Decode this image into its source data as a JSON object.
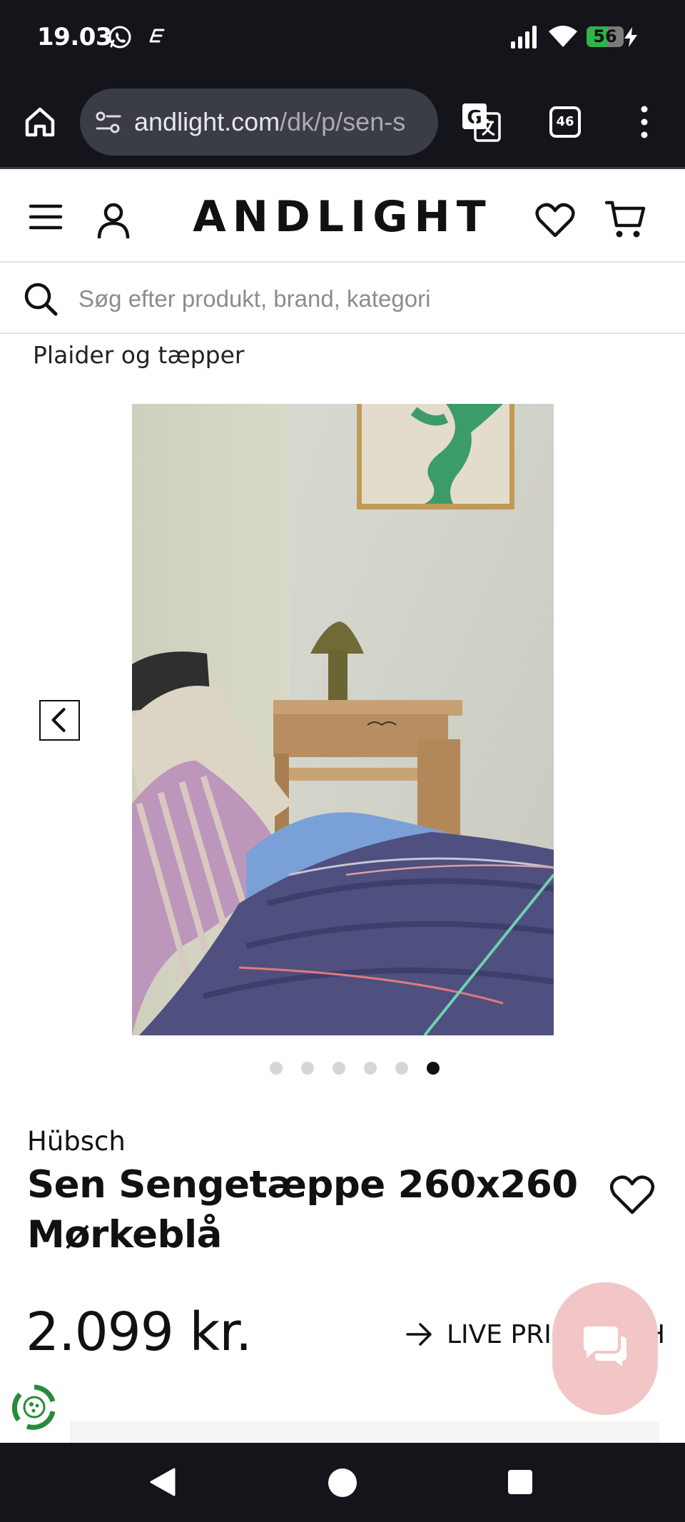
{
  "status_bar": {
    "time": "19.03",
    "battery_percent": "56",
    "battery_level": 0.56,
    "icons": [
      "whatsapp-icon",
      "e-notification-icon",
      "signal-icon",
      "wifi-icon",
      "battery-icon",
      "charging-bolt-icon"
    ]
  },
  "browser": {
    "url_domain": "andlight.com",
    "url_path": "/dk/p/sen-s",
    "tab_count": "46",
    "icons": [
      "home-icon",
      "site-settings-icon",
      "translate-icon",
      "tabs-icon",
      "more-vert-icon"
    ]
  },
  "header": {
    "logo": "ANDLIGHT",
    "icons": [
      "menu-icon",
      "account-icon",
      "heart-icon",
      "cart-icon"
    ]
  },
  "search": {
    "placeholder": "Søg efter produkt, brand, kategori",
    "value": ""
  },
  "breadcrumb": "Plaider og tæpper",
  "carousel": {
    "slide_count": 6,
    "active_index": 5,
    "image_description_icon": "product-photo"
  },
  "product": {
    "brand": "Hübsch",
    "title": "Sen Sengetæppe 260x260 Mørkeblå",
    "price": "2.099 kr.",
    "live_price_label": "LIVE PRIS MATCH"
  },
  "colors": {
    "system_bar": "#14151b",
    "url_pill": "#3a3d45",
    "battery_green": "#2fb34a",
    "chat_bubble": "#f2c6c7",
    "eco_green": "#2a8a3c",
    "active_dot": "#111111",
    "inactive_dot": "#d6d6d6"
  }
}
